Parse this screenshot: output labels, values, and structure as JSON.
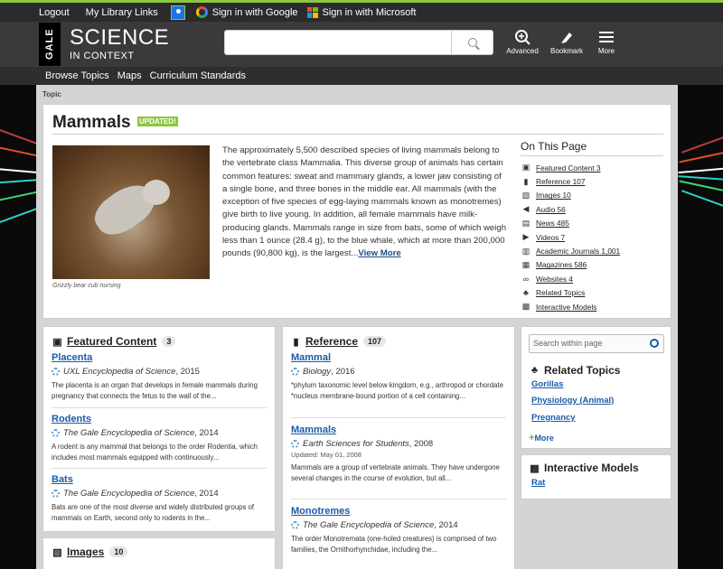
{
  "topbar": {
    "logout": "Logout",
    "my_library_links": "My Library Links",
    "google": "Sign in with Google",
    "microsoft": "Sign in with Microsoft"
  },
  "header": {
    "gale": "GALE",
    "brand_line1": "SCIENCE",
    "brand_line2": "IN CONTEXT",
    "search_placeholder": "",
    "advanced": "Advanced",
    "bookmark": "Bookmark",
    "more": "More"
  },
  "nav": {
    "items": [
      "Browse Topics",
      "Maps",
      "Curriculum Standards"
    ]
  },
  "breadcrumb": "Topic",
  "topic": {
    "title": "Mammals",
    "updated": "UPDATED!",
    "caption": "Grizzly bear cub nursing",
    "summary": "The approximately 5,500 described species of living mammals belong to the vertebrate class Mammalia. This diverse group of animals has certain common features: sweat and mammary glands, a lower jaw consisting of a single bone, and three bones in the middle ear. All mammals (with the exception of five species of egg-laying mammals known as monotremes) give birth to live young. In addition, all female mammals have milk-producing glands. Mammals range in size from bats, some of which weigh less than 1 ounce (28.4 g), to the blue whale, which at more than 200,000 pounds (90,800 kg), is the largest...",
    "view_more": "View More"
  },
  "on_this_page": {
    "title": "On This Page",
    "items": [
      {
        "label": "Featured Content 3",
        "icon": "featured-icon"
      },
      {
        "label": "Reference 107",
        "icon": "book-icon"
      },
      {
        "label": "Images 10",
        "icon": "image-icon"
      },
      {
        "label": "Audio 56",
        "icon": "audio-icon"
      },
      {
        "label": "News 485",
        "icon": "news-icon"
      },
      {
        "label": "Videos 7",
        "icon": "video-icon"
      },
      {
        "label": "Academic Journals 1,001",
        "icon": "journal-icon"
      },
      {
        "label": "Magazines 586",
        "icon": "magazine-icon"
      },
      {
        "label": "Websites 4",
        "icon": "link-icon"
      },
      {
        "label": "Related Topics",
        "icon": "hierarchy-icon"
      },
      {
        "label": "Interactive Models",
        "icon": "model-icon"
      }
    ]
  },
  "featured": {
    "title": "Featured Content",
    "count": "3",
    "entries": [
      {
        "title": "Placenta",
        "source": "UXL Encyclopedia of Science",
        "year": ", 2015",
        "desc": "The placenta is an organ that develops in female mammals during pregnancy that connects the fetus to the wall of the..."
      },
      {
        "title": "Rodents",
        "source": "The Gale Encyclopedia of Science",
        "year": ", 2014",
        "desc": "A rodent is any mammal that belongs to the order Rodentia, which includes most mammals equipped with continuously..."
      },
      {
        "title": "Bats",
        "source": "The Gale Encyclopedia of Science",
        "year": ", 2014",
        "desc": "Bats are one of the most diverse and widely distributed groups of mammals on Earth, second only to rodents in the..."
      }
    ]
  },
  "reference": {
    "title": "Reference",
    "count": "107",
    "entries": [
      {
        "title": "Mammal",
        "source": "Biology",
        "year": ", 2016",
        "updated": "",
        "desc": "*phylum taxonomic level below kingdom, e.g., arthropod or chordate *nucleus membrane-bound portion of a cell containing..."
      },
      {
        "title": "Mammals",
        "source": "Earth Sciences for Students",
        "year": ", 2008",
        "updated": "Updated: May 01, 2008",
        "desc": "Mammals are a group of vertebrate animals. They have undergone several changes in the course of evolution, but all..."
      },
      {
        "title": "Monotremes",
        "source": "The Gale Encyclopedia of Science",
        "year": ", 2014",
        "updated": "",
        "desc": "The order Monotremata (one-holed creatures) is comprised of two families, the Ornithorhynchidae, including the..."
      }
    ]
  },
  "images": {
    "title": "Images",
    "count": "10"
  },
  "sidebar": {
    "search_placeholder": "Search within page",
    "related_title": "Related Topics",
    "related": [
      "Gorillas",
      "Physiology (Animal)",
      "Pregnancy"
    ],
    "more": "More",
    "models_title": "Interactive Models",
    "models": [
      "Rat"
    ]
  },
  "colors": {
    "accent_green": "#8dc63f",
    "link_blue": "#1b5aa8",
    "header_bg": "#3a3a3a"
  }
}
